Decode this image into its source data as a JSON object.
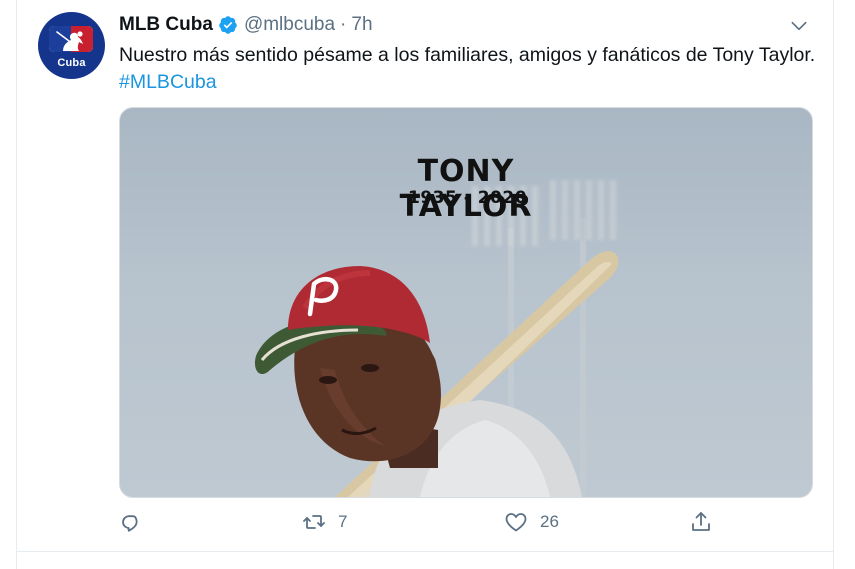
{
  "tweet": {
    "author_name": "MLB Cuba",
    "handle": "@mlbcuba",
    "separator": "·",
    "time": "7h",
    "avatar_label": "Cuba",
    "text": "Nuestro más sentido pésame a los familiares, amigos y fanáticos de Tony Taylor.",
    "hashtag": "#MLBCuba",
    "verified_icon": "verified-badge-icon",
    "menu_icon": "chevron-down-icon"
  },
  "media": {
    "title": "TONY TAYLOR",
    "years": "1935 - 2020"
  },
  "actions": {
    "reply": {
      "icon": "reply-icon",
      "count": ""
    },
    "retweet": {
      "icon": "retweet-icon",
      "count": "7"
    },
    "like": {
      "icon": "heart-icon",
      "count": "26"
    },
    "share": {
      "icon": "share-icon",
      "count": ""
    }
  },
  "colors": {
    "accent": "#1b95e0",
    "verified": "#1da1f2",
    "secondary_text": "#5b7083",
    "primary_text": "#0f1419"
  }
}
